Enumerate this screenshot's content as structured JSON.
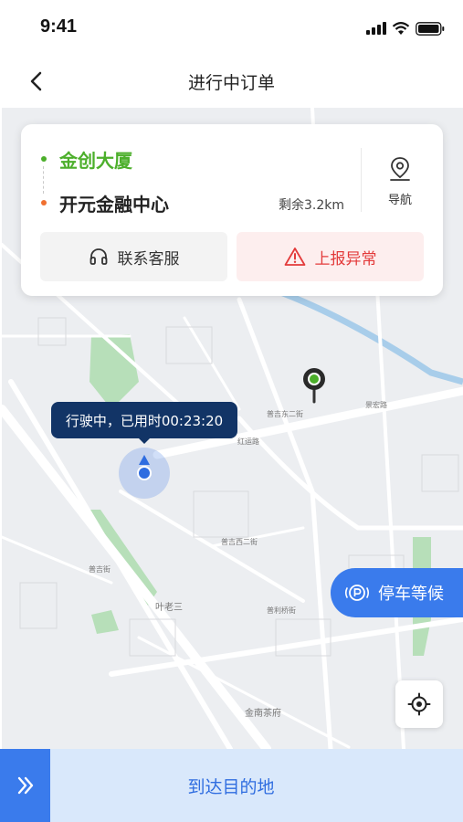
{
  "status_bar": {
    "time": "9:41"
  },
  "nav": {
    "title": "进行中订单"
  },
  "route": {
    "start": "金创大厦",
    "end": "开元金融中心",
    "remaining": "剩余3.2km",
    "navigate_label": "导航"
  },
  "actions": {
    "service_label": "联系客服",
    "report_label": "上报异常"
  },
  "map": {
    "status_bubble": "行驶中，已用时00:23:20",
    "park_wait_label": "停车等候",
    "labels": [
      "叶老三",
      "金南茶府",
      "普吉东二街",
      "红运路",
      "普吉西二街",
      "普利桥街",
      "景宏路",
      "普吉街"
    ]
  },
  "bottom": {
    "arrive_label": "到达目的地"
  },
  "colors": {
    "accent": "#3a7bec",
    "start": "#4caf2b",
    "end": "#f07030",
    "danger": "#e33a3a",
    "bubble": "#123466"
  }
}
